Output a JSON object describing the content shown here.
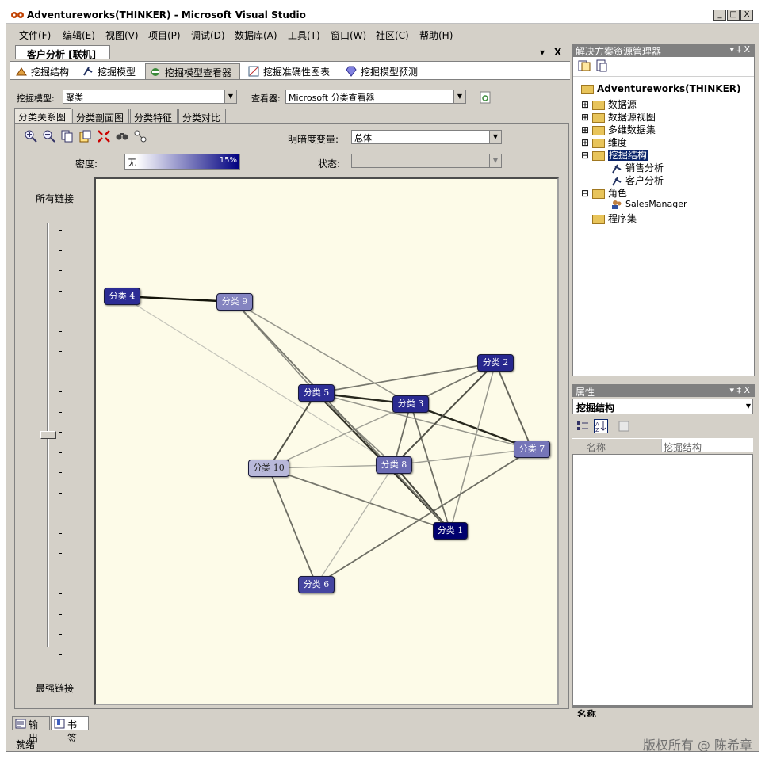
{
  "window": {
    "title": "Adventureworks(THINKER) - Microsoft Visual Studio",
    "min": "_",
    "max": "□",
    "close": "X"
  },
  "menu": [
    "文件(F)",
    "编辑(E)",
    "视图(V)",
    "项目(P)",
    "调试(D)",
    "数据库(A)",
    "工具(T)",
    "窗口(W)",
    "社区(C)",
    "帮助(H)"
  ],
  "doc_tab": {
    "label": "客户分析 [联机]",
    "pin": "▾",
    "close": "X"
  },
  "main_tabs": [
    {
      "label": "挖掘结构",
      "icon": "mining-structure-icon"
    },
    {
      "label": "挖掘模型",
      "icon": "mining-model-icon"
    },
    {
      "label": "挖掘模型查看器",
      "icon": "model-viewer-icon"
    },
    {
      "label": "挖掘准确性图表",
      "icon": "accuracy-chart-icon"
    },
    {
      "label": "挖掘模型预测",
      "icon": "prediction-icon"
    }
  ],
  "viewer": {
    "model_label": "挖掘模型:",
    "model_value": "聚类",
    "viewer_label": "查看器:",
    "viewer_value": "Microsoft 分类查看器"
  },
  "sub_tabs": [
    "分类关系图",
    "分类剖面图",
    "分类特征",
    "分类对比"
  ],
  "diagram": {
    "shading_label": "明暗度变量:",
    "shading_value": "总体",
    "density_label": "密度:",
    "density_min": "无",
    "density_max": "15%",
    "state_label": "状态:",
    "state_value": "",
    "slider_top_label": "所有链接",
    "slider_bottom_label": "最强链接",
    "slider_level": 0.5,
    "nodes": [
      {
        "label": "分类 1",
        "color": "#00006e"
      },
      {
        "label": "分类 2",
        "color": "#27278e"
      },
      {
        "label": "分类 3",
        "color": "#2a2a90"
      },
      {
        "label": "分类 4",
        "color": "#2c2c94"
      },
      {
        "label": "分类 5",
        "color": "#2e2e95"
      },
      {
        "label": "分类 6",
        "color": "#4545a0"
      },
      {
        "label": "分类 7",
        "color": "#7575b8"
      },
      {
        "label": "分类 8",
        "color": "#6b6bb4"
      },
      {
        "label": "分类 9",
        "color": "#8484c0"
      },
      {
        "label": "分类 10",
        "color": "#b8b8da"
      }
    ]
  },
  "bottom_tabs": [
    {
      "label": "输出",
      "icon": "output-icon"
    },
    {
      "label": "书签",
      "icon": "bookmark-icon"
    }
  ],
  "status": {
    "text": "就绪",
    "watermark": "版权所有 @ 陈希章"
  },
  "solution_explorer": {
    "title": "解决方案资源管理器",
    "pin": "▾ ‡ X",
    "root": "Adventureworks(THINKER)",
    "items": [
      "数据源",
      "数据源视图",
      "多维数据集",
      "维度",
      "挖掘结构",
      "销售分析",
      "客户分析",
      "角色",
      "SalesManager",
      "程序集"
    ]
  },
  "properties": {
    "title": "属性",
    "pin": "▾ ‡ X",
    "object": "挖掘结构",
    "col_name": "名称",
    "col_value": "挖掘结构",
    "footer": "名称"
  }
}
